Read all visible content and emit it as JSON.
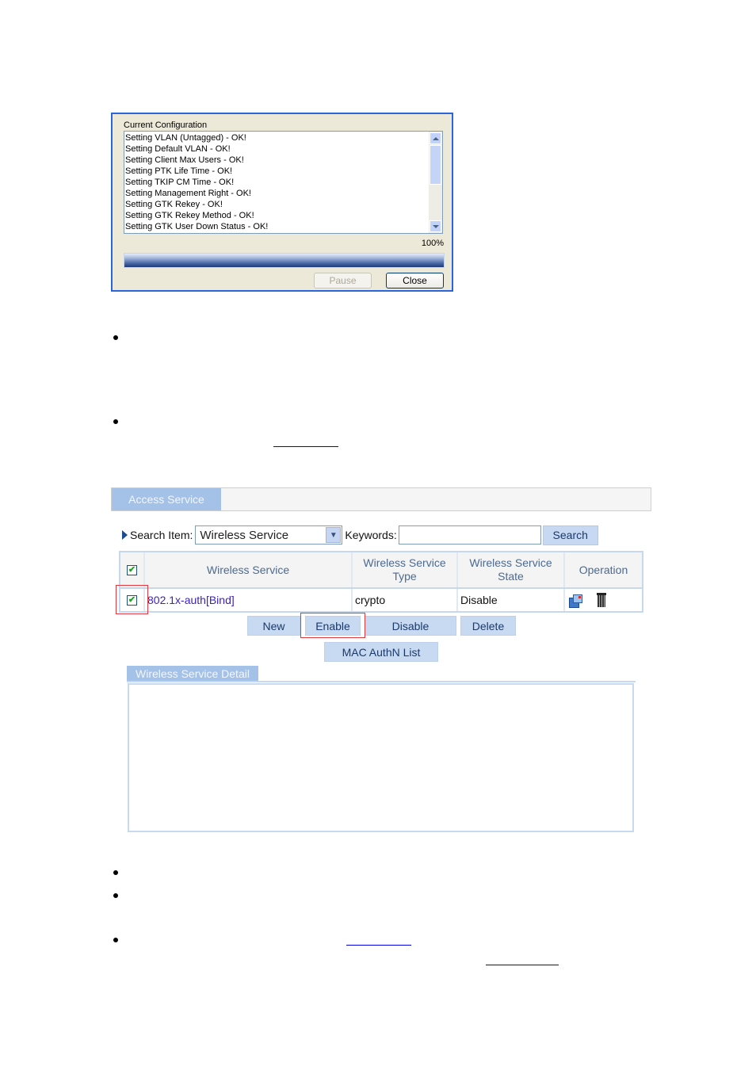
{
  "progress_dialog": {
    "caption": "Current Configuration",
    "log_lines": [
      "Setting VLAN (Untagged) - OK!",
      "Setting Default VLAN - OK!",
      "Setting Client Max Users - OK!",
      "Setting PTK Life Time - OK!",
      "Setting TKIP CM Time - OK!",
      "Setting Management Right - OK!",
      "Setting GTK Rekey - OK!",
      "Setting GTK Rekey Method - OK!",
      "Setting GTK User Down Status - OK!"
    ],
    "percent_label": "100%",
    "progress_fraction": 1.0,
    "pause_label": "Pause",
    "pause_enabled": false,
    "close_label": "Close"
  },
  "access_service": {
    "tab_label": "Access Service",
    "search": {
      "item_label": "Search Item:",
      "item_selected": "Wireless Service",
      "keywords_label": "Keywords:",
      "keywords_value": "",
      "search_button": "Search"
    },
    "table": {
      "headers": [
        "",
        "Wireless Service",
        "Wireless Service Type",
        "Wireless Service State",
        "Operation"
      ],
      "header_checked": true,
      "rows": [
        {
          "checked": true,
          "service": "802.1x-auth[Bind]",
          "type": "crypto",
          "state": "Disable",
          "operations": [
            "modify-icon",
            "delete-icon"
          ]
        }
      ]
    },
    "buttons": {
      "new": "New",
      "enable": "Enable",
      "disable": "Disable",
      "delete": "Delete",
      "mac_authn_list": "MAC AuthN List"
    },
    "detail_tab_label": "Wireless Service Detail",
    "highlight_color": "#e0393e"
  }
}
